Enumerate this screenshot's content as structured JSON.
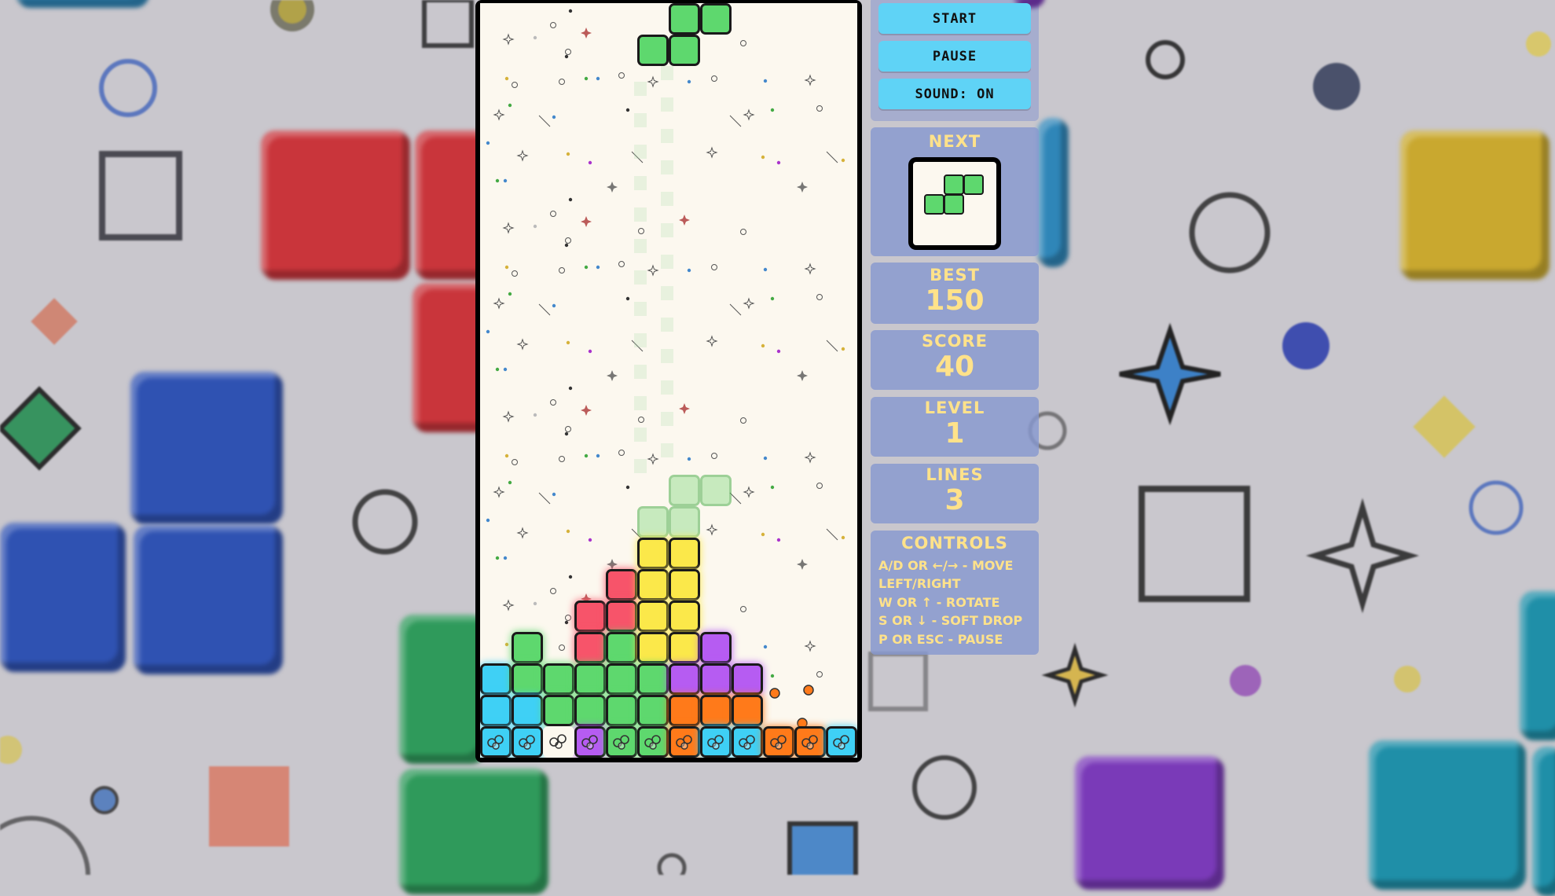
{
  "buttons": {
    "start": "START",
    "pause": "PAUSE",
    "sound": "SOUND: ON"
  },
  "panels": {
    "next": {
      "title": "NEXT",
      "piece": "S"
    },
    "best": {
      "title": "BEST",
      "value": "150"
    },
    "score": {
      "title": "SCORE",
      "value": "40"
    },
    "level": {
      "title": "LEVEL",
      "value": "1"
    },
    "lines": {
      "title": "LINES",
      "value": "3"
    }
  },
  "controls": {
    "title": "CONTROLS",
    "lines": [
      "A/D OR ←/→ - MOVE",
      "LEFT/RIGHT",
      "W OR ↑ - ROTATE",
      "S OR ↓ - SOFT DROP",
      "P OR ESC - PAUSE"
    ]
  },
  "colors": {
    "cyan": "#3fd0f5",
    "green": "#5ed86e",
    "yellow": "#fbe84a",
    "red": "#f7546a",
    "purple": "#b65cf2",
    "orange": "#ff7a1a",
    "button": "#5fd3f6",
    "panel": "#8898d0",
    "panel_text": "#ffe28a"
  },
  "board": {
    "columns": 12,
    "rows": 24,
    "active_piece": {
      "type": "S",
      "color": "green",
      "cells": [
        [
          6,
          0
        ],
        [
          7,
          0
        ],
        [
          5,
          1
        ],
        [
          6,
          1
        ]
      ]
    },
    "ghost_piece": {
      "type": "S",
      "cells": [
        [
          6,
          15
        ],
        [
          7,
          15
        ],
        [
          5,
          16
        ],
        [
          6,
          16
        ]
      ]
    },
    "locked": [
      [
        "yellow",
        5,
        17
      ],
      [
        "yellow",
        6,
        17
      ],
      [
        "red",
        4,
        18
      ],
      [
        "yellow",
        5,
        18
      ],
      [
        "yellow",
        6,
        18
      ],
      [
        "red",
        3,
        19
      ],
      [
        "red",
        4,
        19
      ],
      [
        "yellow",
        5,
        19
      ],
      [
        "yellow",
        6,
        19
      ],
      [
        "green",
        1,
        20
      ],
      [
        "red",
        3,
        20
      ],
      [
        "green",
        4,
        20
      ],
      [
        "yellow",
        5,
        20
      ],
      [
        "yellow",
        6,
        20
      ],
      [
        "purple",
        7,
        20
      ],
      [
        "cyan",
        0,
        21
      ],
      [
        "green",
        1,
        21
      ],
      [
        "green",
        2,
        21
      ],
      [
        "green",
        3,
        21
      ],
      [
        "green",
        4,
        21
      ],
      [
        "green",
        5,
        21
      ],
      [
        "purple",
        6,
        21
      ],
      [
        "purple",
        7,
        21
      ],
      [
        "purple",
        8,
        21
      ],
      [
        "cyan",
        0,
        22
      ],
      [
        "cyan",
        1,
        22
      ],
      [
        "green",
        2,
        22
      ],
      [
        "green",
        3,
        22
      ],
      [
        "green",
        4,
        22
      ],
      [
        "green",
        5,
        22
      ],
      [
        "orange",
        6,
        22
      ],
      [
        "orange",
        7,
        22
      ],
      [
        "orange",
        8,
        22
      ],
      [
        "cyan",
        0,
        23
      ],
      [
        "cyan",
        1,
        23
      ],
      [
        "purple",
        3,
        23
      ],
      [
        "green",
        4,
        23
      ],
      [
        "green",
        5,
        23
      ],
      [
        "orange",
        6,
        23
      ],
      [
        "cyan",
        7,
        23
      ],
      [
        "cyan",
        8,
        23
      ],
      [
        "orange",
        9,
        23
      ],
      [
        "orange",
        10,
        23
      ],
      [
        "cyan",
        11,
        23
      ]
    ],
    "clearing_row_cells": [
      [
        "cyan",
        0,
        23
      ],
      [
        "cyan",
        1,
        23
      ],
      [
        "green",
        2,
        23
      ]
    ]
  }
}
